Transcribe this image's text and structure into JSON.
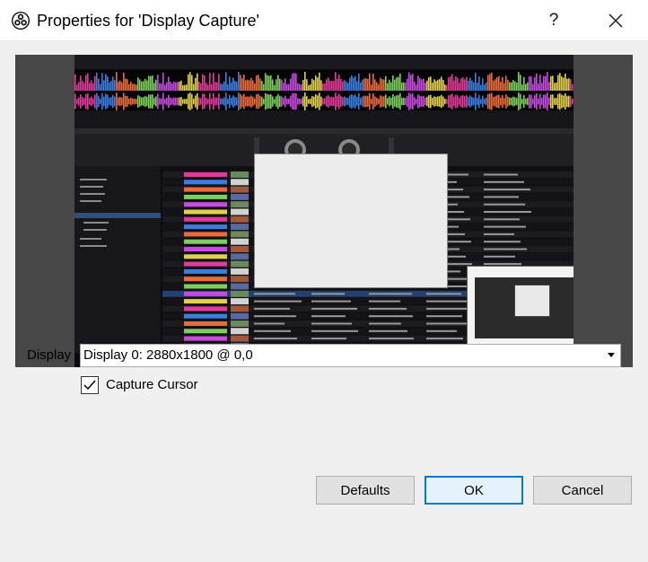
{
  "window": {
    "title": "Properties for 'Display Capture'",
    "help_glyph": "?",
    "close_glyph": "✕",
    "app_icon": "obs-icon"
  },
  "preview": {
    "description_icon": "screen-capture-preview"
  },
  "display": {
    "label": "Display",
    "selected": "Display 0: 2880x1800 @ 0,0"
  },
  "capture_cursor": {
    "label": "Capture Cursor",
    "checked": true
  },
  "buttons": {
    "defaults": "Defaults",
    "ok": "OK",
    "cancel": "Cancel"
  },
  "colors": {
    "accent": "#0078d7",
    "dialog_bg": "#f0f0f0",
    "preview_bg": "#474747"
  }
}
